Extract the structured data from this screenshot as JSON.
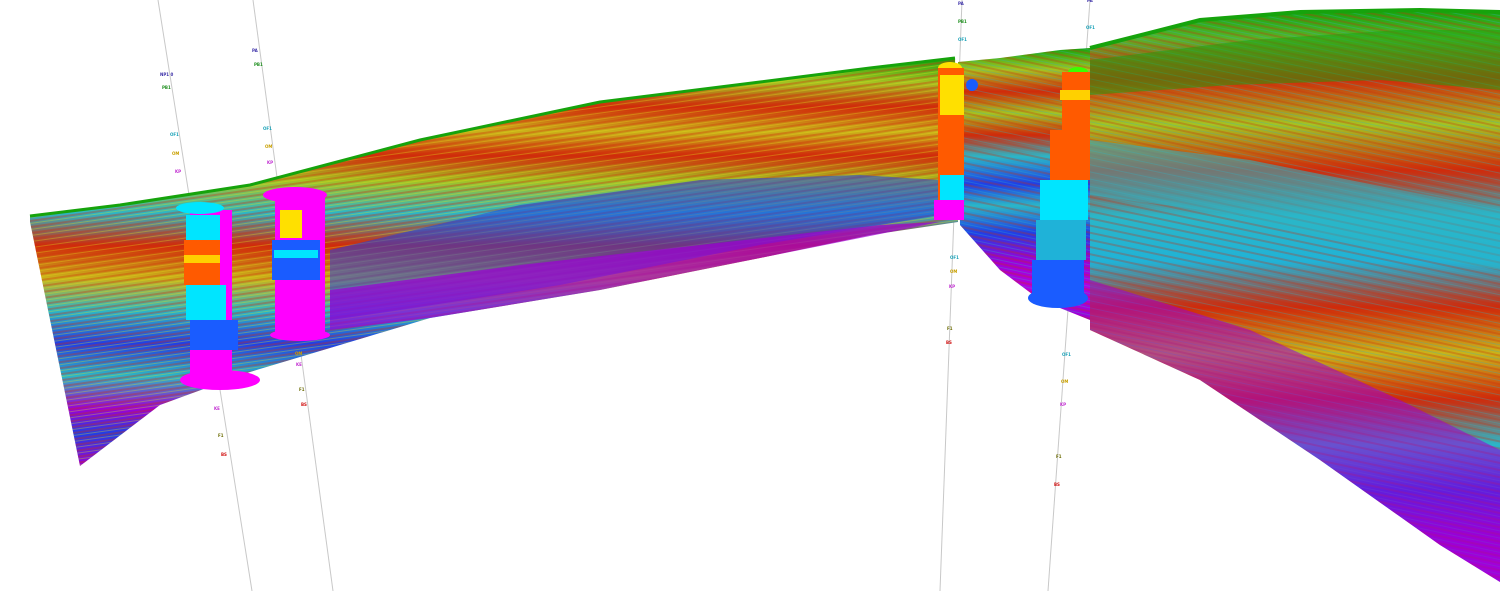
{
  "scene": {
    "background": "#ffffff",
    "palette": [
      "#9b00d6",
      "#1f3ee6",
      "#1fb2d8",
      "#2ab6c8",
      "#a4c422",
      "#c9b41a",
      "#d02a0a",
      "#16a30c",
      "#58b428",
      "#e2e01a",
      "#ff7a00",
      "#ff00ff"
    ],
    "well_core_colors": [
      "#ff00ff",
      "#1a5cff",
      "#00e5ff",
      "#ffe000",
      "#ff5a00",
      "#ffd000",
      "#3cff00"
    ],
    "well_line_color": "#bdbdbd",
    "well_labels": [
      {
        "text": "NP1 0",
        "color": "#3b2fa8"
      },
      {
        "text": "PB1",
        "color": "#1f8f1f"
      },
      {
        "text": "OF1",
        "color": "#1aa2b8"
      },
      {
        "text": "OM",
        "color": "#c9a000"
      },
      {
        "text": "KP",
        "color": "#c02ad0"
      },
      {
        "text": "PA",
        "color": "#3b2fa8"
      },
      {
        "text": "KE",
        "color": "#c02ad0"
      },
      {
        "text": "F1",
        "color": "#6b6b00"
      },
      {
        "text": "BS",
        "color": "#d01010"
      }
    ]
  }
}
